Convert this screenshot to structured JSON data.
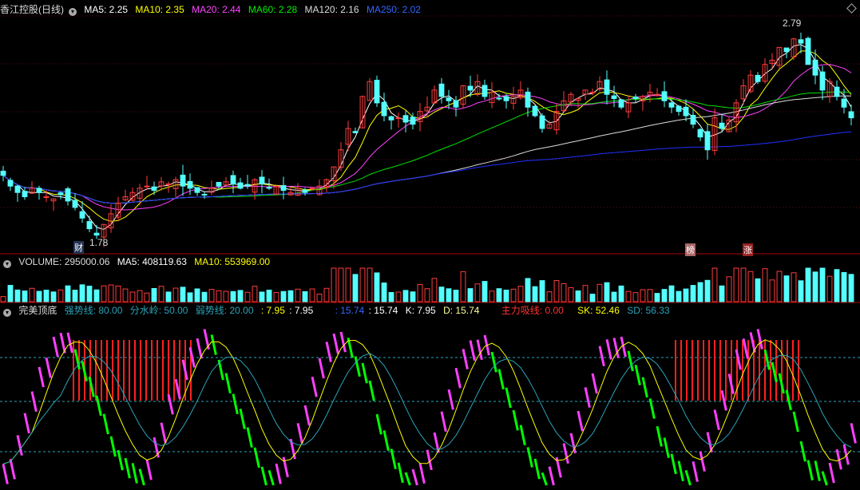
{
  "price_header": {
    "title": "香江控股(日线)",
    "ma5": "MA5: 2.25",
    "ma10": "MA10: 2.35",
    "ma20": "MA20: 2.44",
    "ma60": "MA60: 2.28",
    "ma120": "MA120: 2.16",
    "ma250": "MA250: 2.02"
  },
  "price_annotations": {
    "high": "2.79",
    "low": "1.78",
    "badge_cai": "财",
    "badge_bang": "榜",
    "badge_zhang": "涨"
  },
  "volume_header": {
    "title": "VOLUME: 295000.06",
    "ma5": "MA5: 408119.63",
    "ma10": "MA10: 553969.00"
  },
  "indicator_header": {
    "title": "完美顶底",
    "strong": "强势线: 80.00",
    "ridge": "分水岭: 50.00",
    "weak": "弱势线: 20.00",
    "v1": ": 7.95",
    "v2": ": 7.95",
    "v3": ": 15.74",
    "v4": ": 15.74",
    "k": "K: 7.95",
    "d": "D: 15.74",
    "zl": "主力吸线: 0.00",
    "sk": "SK: 52.46",
    "sd": "SD: 56.33"
  },
  "colors": {
    "bg": "#000000",
    "up": "#ff3c3c",
    "down": "#54ffff",
    "ma5": "#ffffff",
    "ma10": "#ffff00",
    "ma20": "#ff40ff",
    "ma60": "#00e000",
    "ma120": "#dcdcdc",
    "ma250": "#2030ff",
    "osc_up": "#ff40ff",
    "osc_down": "#00ff00",
    "zone": "#ff2020",
    "guide": "#2aa3b8"
  },
  "chart_data": {
    "type": "candlestick",
    "closes": [
      2.08,
      2.03,
      2.0,
      1.98,
      2.02,
      2.0,
      1.98,
      1.97,
      1.99,
      1.96,
      1.93,
      1.88,
      1.83,
      1.8,
      1.85,
      1.9,
      1.95,
      1.98,
      2.0,
      2.02,
      2.03,
      2.01,
      2.05,
      2.04,
      2.06,
      2.03,
      2.02,
      2.0,
      1.99,
      2.02,
      2.03,
      2.05,
      2.04,
      2.02,
      2.03,
      2.06,
      2.04,
      2.02,
      2.03,
      2.01,
      2.0,
      2.02,
      2.0,
      2.02,
      2.03,
      2.06,
      2.12,
      2.2,
      2.3,
      2.28,
      2.45,
      2.52,
      2.42,
      2.36,
      2.34,
      2.35,
      2.33,
      2.32,
      2.38,
      2.4,
      2.48,
      2.45,
      2.43,
      2.4,
      2.5,
      2.48,
      2.52,
      2.45,
      2.47,
      2.44,
      2.43,
      2.45,
      2.48,
      2.4,
      2.36,
      2.3,
      2.32,
      2.38,
      2.43,
      2.46,
      2.44,
      2.48,
      2.47,
      2.52,
      2.46,
      2.44,
      2.4,
      2.42,
      2.44,
      2.45,
      2.47,
      2.46,
      2.43,
      2.4,
      2.38,
      2.36,
      2.32,
      2.26,
      2.2,
      2.35,
      2.3,
      2.34,
      2.42,
      2.5,
      2.55,
      2.52,
      2.6,
      2.62,
      2.68,
      2.66,
      2.72,
      2.7,
      2.6,
      2.55,
      2.48,
      2.52,
      2.45,
      2.4,
      2.35
    ],
    "ma_values": {
      "MA5": 2.25,
      "MA10": 2.35,
      "MA20": 2.44,
      "MA60": 2.28,
      "MA120": 2.16,
      "MA250": 2.02
    },
    "high": 2.79,
    "low": 1.78
  }
}
